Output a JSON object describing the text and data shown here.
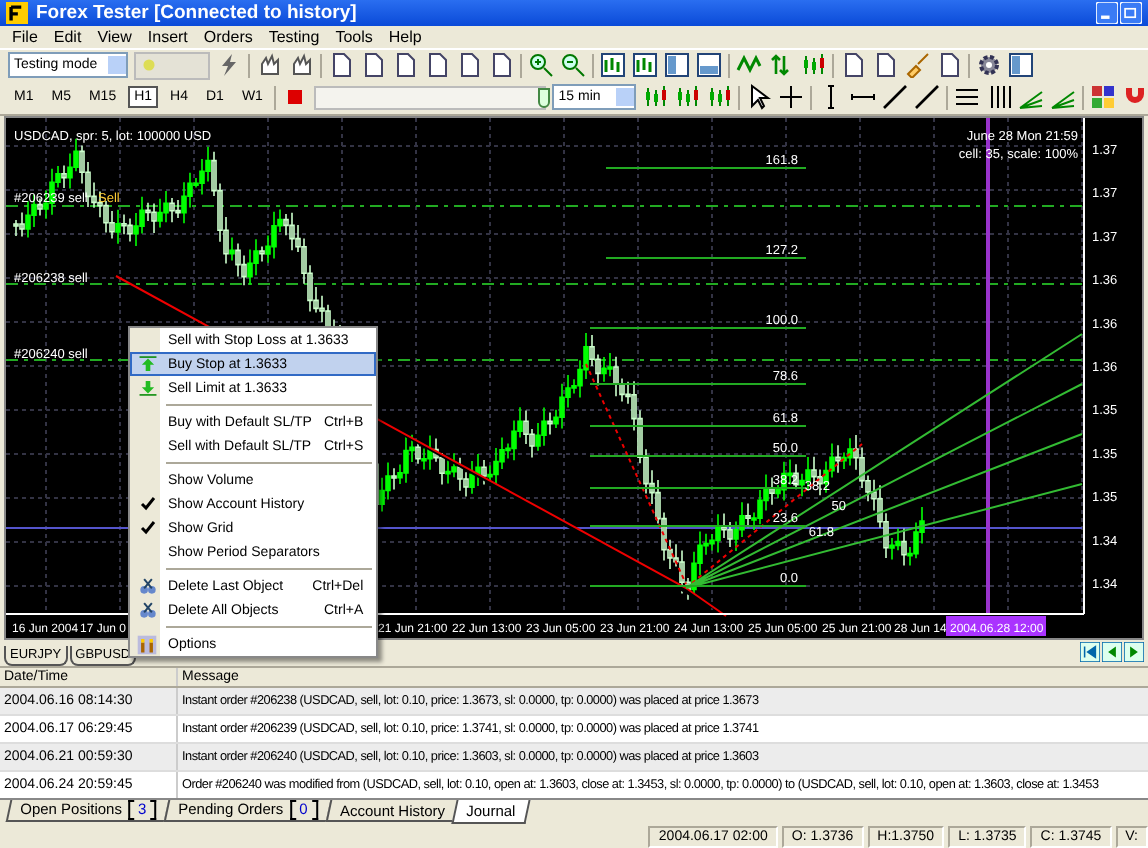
{
  "window": {
    "title": "Forex Tester [Connected to history]"
  },
  "menu_bar": [
    "File",
    "Edit",
    "View",
    "Insert",
    "Orders",
    "Testing",
    "Tools",
    "Help"
  ],
  "toolbar": {
    "mode_select": "Testing mode",
    "timeframes": [
      {
        "label": "M1",
        "selected": false
      },
      {
        "label": "M5",
        "selected": false
      },
      {
        "label": "M15",
        "selected": false
      },
      {
        "label": "H1",
        "selected": true
      },
      {
        "label": "H4",
        "selected": false
      },
      {
        "label": "D1",
        "selected": false
      },
      {
        "label": "W1",
        "selected": false
      }
    ],
    "speed_slider": {
      "level": 0.97
    },
    "period_select": "15 min"
  },
  "chart": {
    "symbol_info": "USDCAD, spr: 5, lot: 100000 USD",
    "date_info": "June 28 Mon 21:59",
    "cell_info": "cell: 35, scale: 100%",
    "order_labels": [
      "#206239 sell",
      "#206238 sell",
      "#206240 sell"
    ],
    "sell_marker": "Sell",
    "fibonacci_levels": [
      "161.8",
      "127.2",
      "100.0",
      "78.6",
      "61.8",
      "50.0",
      "38.2",
      "23.6",
      "0.0"
    ],
    "fan_levels": [
      "38.2",
      "50",
      "61.8"
    ],
    "price_axis": [
      "1.37",
      "1.37",
      "1.37",
      "1.36",
      "1.36",
      "1.36",
      "1.35",
      "1.35",
      "1.35",
      "1.34",
      "1.34"
    ],
    "time_axis": [
      "16 Jun 2004",
      "17 Jun 0",
      "21 Jun 21:00",
      "22 Jun 13:00",
      "23 Jun 05:00",
      "23 Jun 21:00",
      "24 Jun 13:00",
      "25 Jun 05:00",
      "25 Jun 21:00",
      "28 Jun 14"
    ],
    "cursor_time": "2004.06.28 12:00"
  },
  "chart_tabs": [
    {
      "label": "EURJPY",
      "selected": false
    },
    {
      "label": "GBPUSD",
      "selected": false
    }
  ],
  "context_menu": [
    {
      "kind": "plain",
      "label": "Sell with Stop Loss at 1.3633",
      "selected": false
    },
    {
      "kind": "arrow_up",
      "label": "Buy Stop at 1.3633",
      "selected": true
    },
    {
      "kind": "arrow_down",
      "label": "Sell Limit at 1.3633",
      "selected": false
    },
    {
      "kind": "separator"
    },
    {
      "kind": "plain",
      "label": "Buy with Default SL/TP",
      "shortcut": "Ctrl+B",
      "selected": false
    },
    {
      "kind": "plain",
      "label": "Sell with Default SL/TP",
      "shortcut": "Ctrl+S",
      "selected": false
    },
    {
      "kind": "separator"
    },
    {
      "kind": "toggle",
      "label": "Show Volume",
      "checked": false,
      "selected": false
    },
    {
      "kind": "toggle",
      "label": "Show Account History",
      "checked": true,
      "selected": false
    },
    {
      "kind": "toggle",
      "label": "Show Grid",
      "checked": true,
      "selected": false
    },
    {
      "kind": "toggle",
      "label": "Show Period Separators",
      "checked": false,
      "selected": false
    },
    {
      "kind": "separator"
    },
    {
      "kind": "delete",
      "label": "Delete Last Object",
      "shortcut": "Ctrl+Del",
      "selected": false
    },
    {
      "kind": "delete",
      "label": "Delete All Objects",
      "shortcut": "Ctrl+A",
      "selected": false
    },
    {
      "kind": "separator"
    },
    {
      "kind": "options",
      "label": "Options",
      "selected": false
    }
  ],
  "journal": {
    "columns": [
      "Date/Time",
      "Message"
    ],
    "rows": [
      {
        "time": "2004.06.16 08:14:30",
        "message": "Instant order #206238 (USDCAD, sell, lot: 0.10, price: 1.3673, sl: 0.0000, tp: 0.0000) was placed at price 1.3673"
      },
      {
        "time": "2004.06.17 06:29:45",
        "message": "Instant order #206239 (USDCAD, sell, lot: 0.10, price: 1.3741, sl: 0.0000, tp: 0.0000) was placed at price 1.3741"
      },
      {
        "time": "2004.06.21 00:59:30",
        "message": "Instant order #206240 (USDCAD, sell, lot: 0.10, price: 1.3603, sl: 0.0000, tp: 0.0000) was placed at price 1.3603"
      },
      {
        "time": "2004.06.24 20:59:45",
        "message": "Order #206240 was modified from (USDCAD, sell, lot: 0.10, open at: 1.3603, close at: 1.3453, sl: 0.0000, tp: 0.0000) to (USDCAD, sell, lot: 0.10, open at: 1.3603, close at: 1.3453"
      }
    ]
  },
  "panel_tabs": [
    {
      "label": "Open Positions",
      "count": "3",
      "selected": false
    },
    {
      "label": "Pending Orders",
      "count": "0",
      "selected": false
    },
    {
      "label": "Account History",
      "selected": false
    },
    {
      "label": "Journal",
      "selected": true
    }
  ],
  "status_bar": [
    "2004.06.17 02:00",
    "O: 1.3736",
    "H:1.3750",
    "L: 1.3735",
    "C: 1.3745",
    "V:"
  ]
}
